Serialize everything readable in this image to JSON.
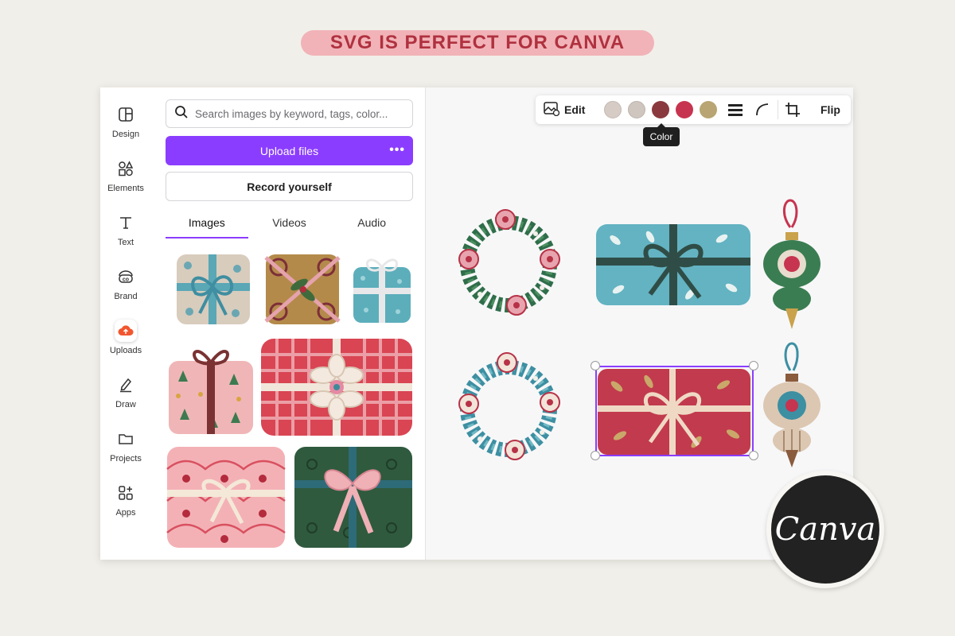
{
  "banner": {
    "text": "SVG IS PERFECT FOR CANVA"
  },
  "sidebar": {
    "items": [
      {
        "label": "Design",
        "icon": "design-icon"
      },
      {
        "label": "Elements",
        "icon": "elements-icon"
      },
      {
        "label": "Text",
        "icon": "text-icon"
      },
      {
        "label": "Brand",
        "icon": "brand-icon"
      },
      {
        "label": "Uploads",
        "icon": "upload-cloud-icon",
        "active": true
      },
      {
        "label": "Draw",
        "icon": "draw-icon"
      },
      {
        "label": "Projects",
        "icon": "folder-icon"
      },
      {
        "label": "Apps",
        "icon": "apps-icon"
      }
    ]
  },
  "panel": {
    "search_placeholder": "Search images by keyword, tags, color...",
    "upload_label": "Upload files",
    "more_label": "•••",
    "record_label": "Record yourself",
    "tabs": [
      {
        "label": "Images",
        "active": true
      },
      {
        "label": "Videos"
      },
      {
        "label": "Audio"
      }
    ]
  },
  "toolbar": {
    "edit_label": "Edit",
    "flip_label": "Flip",
    "swatches": [
      "#d6ccc5",
      "#cfc6bf",
      "#8a3a3e",
      "#c7344f",
      "#b8a573"
    ],
    "tooltip": "Color"
  },
  "colors": {
    "accent": "#8b3dff",
    "banner_bg": "#f1b3b8",
    "banner_text": "#b0313f"
  },
  "logo": {
    "text": "Canva"
  }
}
